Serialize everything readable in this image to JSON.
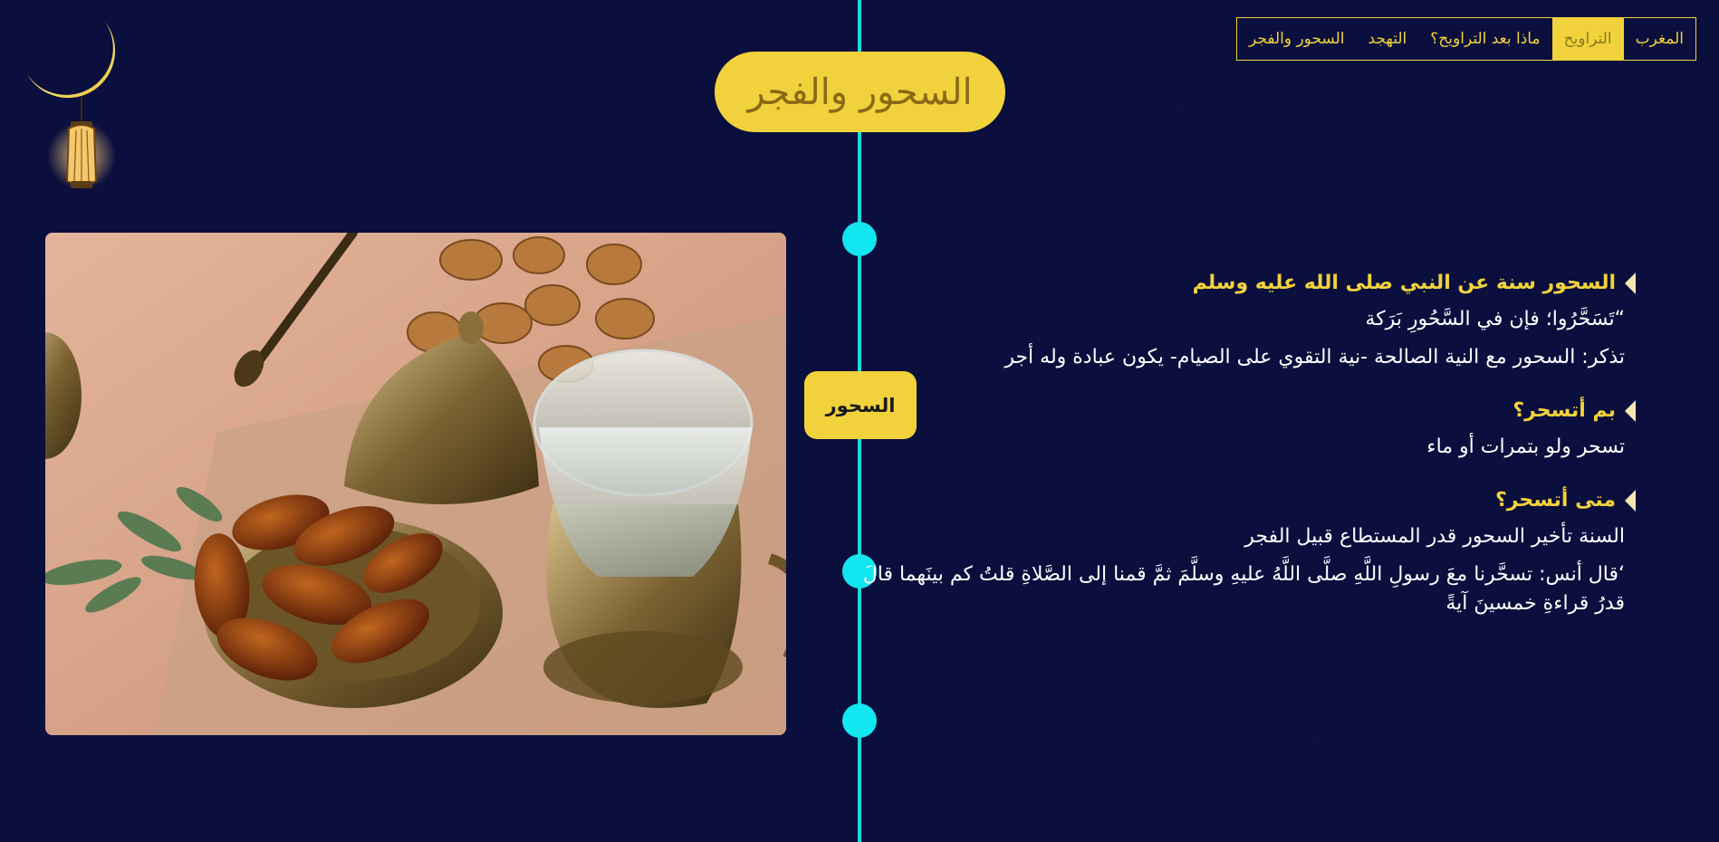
{
  "nav": {
    "items": [
      {
        "label": "المغرب",
        "active": false
      },
      {
        "label": "التراويح",
        "active": true
      },
      {
        "label": "ماذا بعد التراويح؟",
        "active": false
      },
      {
        "label": "التهجد",
        "active": false
      },
      {
        "label": "السحور والفجر",
        "active": false
      }
    ]
  },
  "page_title": "السحور والفجر",
  "timeline_label": "السحور",
  "sections": [
    {
      "heading": "السحور سنة عن النبي صلى الله عليه وسلم",
      "paragraphs": [
        "“تَسَحَّرُوا؛ فإن في السَّحُورِ بَرَكة",
        "تذكر: السحور مع النية الصالحة -نية التقوي على الصيام- يكون عبادة وله أجر"
      ]
    },
    {
      "heading": "بم أتسحر؟",
      "paragraphs": [
        "تسحر ولو بتمرات أو ماء"
      ]
    },
    {
      "heading": "متى أتسحر؟",
      "paragraphs": [
        "السنة تأخير السحور قدر المستطاع قبيل الفجر",
        "‘قال أنس: تسحَّرنا معَ رسولِ اللَّهِ صلَّى اللَّهُ عليهِ وسلَّمَ ثمَّ قمنا إلى الصَّلاةِ قلتُ كم بينَهما قالَ قدرُ قراءةِ خمسينَ آيةً"
      ]
    }
  ],
  "colors": {
    "background": "#0a0f3d",
    "accent": "#f2d23c",
    "timeline": "#1fd6e0",
    "text": "#ffffff"
  },
  "icons": {
    "logo": "crescent-lantern-icon",
    "bullet": "triangle-left-icon"
  }
}
